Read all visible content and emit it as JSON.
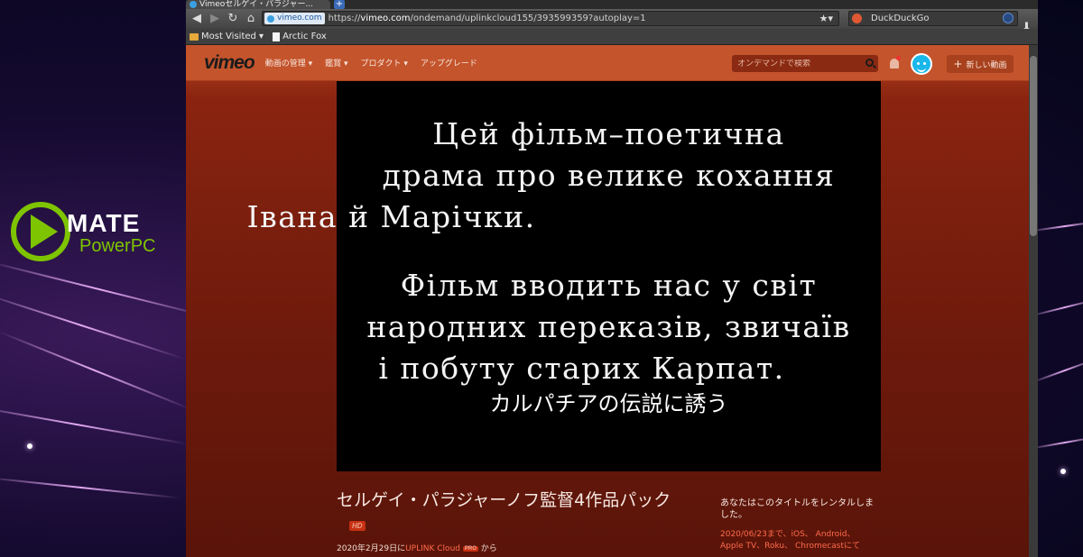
{
  "desktop": {
    "logo_word_1": "MATE",
    "logo_word_2": "PowerPC"
  },
  "browser": {
    "tab_title": "Vimeoセルゲイ・パラジャー...",
    "new_tab": "+",
    "url_chip": "vimeo.com",
    "url_prefix": "https://",
    "url_host": "vimeo.com",
    "url_path": "/ondemand/uplinkcloud155/393599359?autoplay=1",
    "search_engine": "DuckDuckGo",
    "bookmarks": [
      "Most Visited ▾",
      "Arctic Fox"
    ]
  },
  "vimeo": {
    "logo": "vimeo",
    "nav": [
      "動画の管理 ▾",
      "鑑賞 ▾",
      "プロダクト ▾",
      "アップグレード"
    ],
    "search_placeholder": "オンデマンドで検索",
    "new_video": "新しい動画"
  },
  "player": {
    "ua_lines_1": [
      "Цей  фільм–поетична",
      "драма про велике кохання",
      "Івана й Марічки."
    ],
    "ua_lines_2": [
      "Фільм вводить нас у світ",
      "народних переказів, звичаїв",
      "і побуту  старих  Карпат."
    ],
    "subtitle": "カルパチアの伝説に誘う"
  },
  "video": {
    "title": "セルゲイ・パラジャーノフ監督4作品パック",
    "hd": "HD",
    "date": "2020年2月29日に",
    "uploader": "UPLINK Cloud",
    "pro": "PRO",
    "from": " から",
    "rental_info": "あなたはこのタイトルをレンタルしました。",
    "rental_detail": "2020/06/23まで、iOS、 Android、 Apple TV、Roku、 Chromecastにて"
  },
  "colors": {
    "vimeo_header": "#c4542c",
    "mate_green": "#7ec400",
    "vimeo_blue": "#1ab7ea",
    "link_red": "#ff6a4a"
  }
}
